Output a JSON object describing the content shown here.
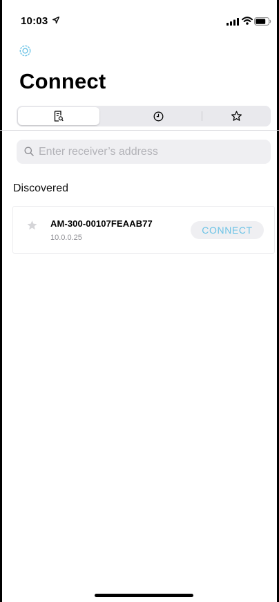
{
  "status_bar": {
    "time": "10:03"
  },
  "header": {
    "title": "Connect"
  },
  "tabs": [
    {
      "icon": "document-search-icon",
      "selected": true
    },
    {
      "icon": "clock-icon",
      "selected": false
    },
    {
      "icon": "star-icon",
      "selected": false
    }
  ],
  "search": {
    "placeholder": "Enter receiver’s address",
    "value": ""
  },
  "discovered": {
    "title": "Discovered",
    "devices": [
      {
        "name": "AM-300-00107FEAAB77",
        "ip": "10.0.0.25",
        "favorite": false,
        "action_label": "CONNECT"
      }
    ]
  },
  "colors": {
    "accent": "#6cc3e6",
    "segment_bg": "#e9e9ed",
    "search_bg": "#efeff2",
    "secondary_text": "#8e8e93"
  }
}
